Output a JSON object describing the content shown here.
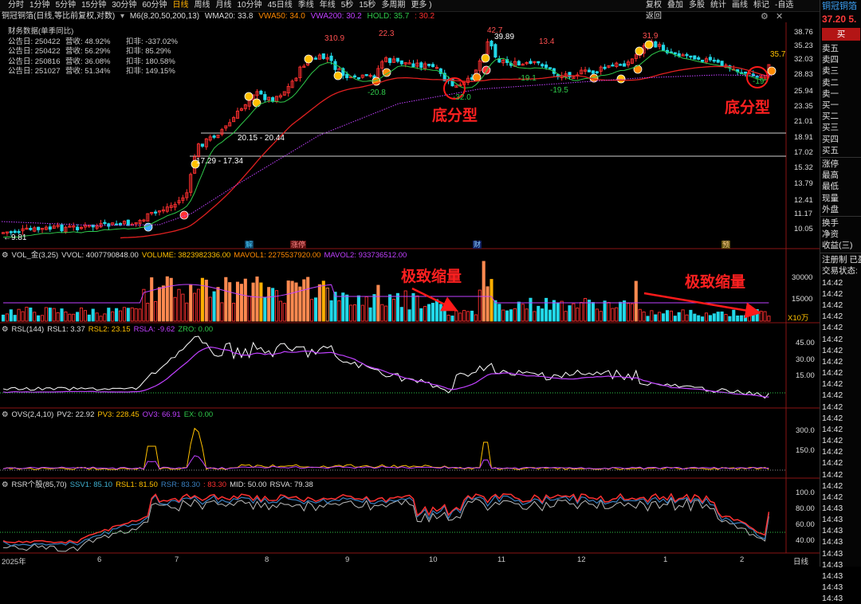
{
  "toolbar": {
    "periods": [
      "分时",
      "1分钟",
      "5分钟",
      "15分钟",
      "30分钟",
      "60分钟",
      "日线",
      "周线",
      "月线",
      "10分钟",
      "45日线",
      "季线",
      "年线",
      "5秒",
      "15秒",
      "多周期",
      "更多 )"
    ],
    "active_period": "日线",
    "right": [
      "复权",
      "叠加",
      "多股",
      "统计",
      "画线",
      "标记",
      "-自选",
      "返回"
    ]
  },
  "title_row": {
    "stock": "铜冠铜箔(日线,等比前复权,对数)",
    "m6": "M6(8,20,50,200,13)",
    "wma20": "WMA20: 33.8",
    "vwa50": "VWA50: 34.0",
    "vwa200": "VWA200: 30.2",
    "hold": "HOLD: 35.7",
    "hold2": ": 30.2"
  },
  "financials": {
    "title": "财务数据(单季同比)",
    "rows": [
      {
        "date": "公告日: 250422",
        "rev": "营收:  48.92%",
        "kf": "扣非:  -337.02%"
      },
      {
        "date": "公告日: 250422",
        "rev": "营收:  56.29%",
        "kf": "扣非:  85.29%"
      },
      {
        "date": "公告日: 250816",
        "rev": "营收:  36.08%",
        "kf": "扣非:  180.58%"
      },
      {
        "date": "公告日: 251027",
        "rev": "营收:  51.34%",
        "kf": "扣非:  149.15%"
      }
    ]
  },
  "price_axis": [
    "38.76",
    "35.23",
    "32.03",
    "28.83",
    "25.94",
    "23.35",
    "21.01",
    "18.91",
    "17.02",
    "15.32",
    "13.79",
    "12.41",
    "11.17",
    "10.05"
  ],
  "price_labels": {
    "p1": "310.9",
    "p2": "22.3",
    "p3": "42.7",
    "p3b": "39.89",
    "p4": "13.4",
    "p5": "31.9",
    "p6": "35.7",
    "n1": "-20.8",
    "n2": "-32.0",
    "n3": "-19.1",
    "n4": "-19.5",
    "n5": "-19.",
    "r1": "20.15 - 20.44",
    "r2": "17.29 - 17.34",
    "low": "9.81"
  },
  "annotations": {
    "bottom1": "底分型",
    "bottom2": "底分型",
    "shrink1": "极致缩量",
    "shrink2": "极致缩量"
  },
  "event_tags": {
    "t1": "解",
    "t2": "涨停",
    "t3": "财",
    "t4": "预"
  },
  "volume": {
    "hdr_name": "VOL_金(3,25)",
    "vvol": "VVOL: 4007790848.00",
    "volume": "VOLUME: 3823982336.00",
    "mavol1": "MAVOL1: 2275537920.00",
    "mavol2": "MAVOL2: 933736512.00",
    "axis": [
      "30000",
      "15000"
    ],
    "unit": "X10万"
  },
  "rsl": {
    "hdr_name": "RSL(144)",
    "rsl1": "RSL1: 3.37",
    "rsl2": "RSL2: 23.15",
    "rsla": "RSLA: -9.62",
    "zro": "ZRO: 0.00",
    "axis": [
      "45.00",
      "30.00",
      "15.00"
    ]
  },
  "ovs": {
    "hdr_name": "OVS(2,4,10)",
    "pv2": "PV2: 22.92",
    "pv3": "PV3: 228.45",
    "ov3": "OV3: 66.91",
    "ex": "EX: 0.00",
    "axis": [
      "300.0",
      "150.0"
    ]
  },
  "rsr": {
    "hdr_name": "RSR个股(85,70)",
    "ssv1": "SSV1: 85.10",
    "rsl1": "RSL1: 81.50",
    "rsr": "RSR: 83.30",
    "rsr2": ": 83.30",
    "mid": "MID: 50.00",
    "rsva": "RSVA: 79.38",
    "axis": [
      "100.0",
      "80.00",
      "60.00",
      "40.00"
    ]
  },
  "x_axis": {
    "year": "2025年",
    "months": [
      "6",
      "7",
      "8",
      "9",
      "10",
      "11",
      "12",
      "1",
      "2"
    ],
    "period": "日线"
  },
  "right_panel": {
    "name": "铜冠铜箔",
    "price": "37.20",
    "change": "5.",
    "buy": "买",
    "order_book": [
      "卖五",
      "卖四",
      "卖三",
      "卖二",
      "卖一",
      "买一",
      "买二",
      "买三",
      "买四",
      "买五"
    ],
    "stats": [
      "涨停",
      "最高",
      "最低",
      "现量",
      "外盘"
    ],
    "stats2": [
      "换手",
      "净资",
      "收益(三)"
    ],
    "reg": "注册制 已盈",
    "trade_status": "交易状态:",
    "times": [
      "14:42",
      "14:42",
      "14:42",
      "14:42",
      "14:42",
      "14:42",
      "14:42",
      "14:42",
      "14:42",
      "14:42",
      "14:42",
      "14:42",
      "14:42",
      "14:42",
      "14:42",
      "14:42",
      "14:42",
      "14:42",
      "14:42",
      "14:42",
      "14:43",
      "14:43",
      "14:43",
      "14:43",
      "14:43",
      "14:43",
      "14:43",
      "14:43",
      "14:43"
    ]
  },
  "colors": {
    "up": "#ff3030",
    "down": "#22d8e8",
    "ma_green": "#2fc94a",
    "ma_red": "#e02020",
    "ma_purple": "#c040ff",
    "yellow": "#ffc000"
  }
}
